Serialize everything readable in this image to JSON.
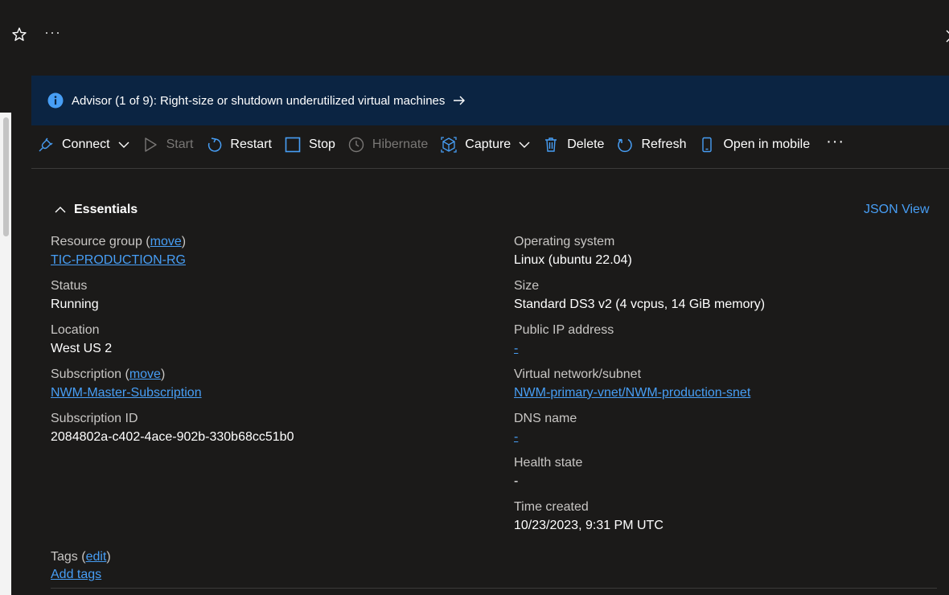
{
  "topbar": {
    "more": "···"
  },
  "advisor": {
    "text": "Advisor (1 of 9): Right-size or shutdown underutilized virtual machines"
  },
  "toolbar": {
    "connect": "Connect",
    "start": "Start",
    "restart": "Restart",
    "stop": "Stop",
    "hibernate": "Hibernate",
    "capture": "Capture",
    "delete": "Delete",
    "refresh": "Refresh",
    "open_mobile": "Open in mobile",
    "more": "···"
  },
  "essentials": {
    "title": "Essentials",
    "json_view": "JSON View",
    "left": {
      "resource_group_label": "Resource group",
      "resource_group_move": "move",
      "resource_group_value": "TIC-PRODUCTION-RG",
      "status_label": "Status",
      "status_value": "Running",
      "location_label": "Location",
      "location_value": "West US 2",
      "subscription_label": "Subscription",
      "subscription_move": "move",
      "subscription_value": "NWM-Master-Subscription",
      "subscription_id_label": "Subscription ID",
      "subscription_id_value": "2084802a-c402-4ace-902b-330b68cc51b0"
    },
    "right": {
      "os_label": "Operating system",
      "os_value": "Linux (ubuntu 22.04)",
      "size_label": "Size",
      "size_value": "Standard DS3 v2 (4 vcpus, 14 GiB memory)",
      "public_ip_label": "Public IP address",
      "public_ip_value": "-",
      "vnet_label": "Virtual network/subnet",
      "vnet_value": "NWM-primary-vnet/NWM-production-snet",
      "dns_label": "DNS name",
      "dns_value": "-",
      "health_label": "Health state",
      "health_value": "-",
      "time_label": "Time created",
      "time_value": "10/23/2023, 9:31 PM UTC"
    },
    "tags": {
      "label": "Tags",
      "edit": "edit",
      "add": "Add tags"
    }
  },
  "colors": {
    "background": "#1b1a19",
    "advisor_bg": "#0b2442",
    "link": "#479ef5",
    "icon_blue": "#479ef5",
    "disabled": "#797775"
  }
}
